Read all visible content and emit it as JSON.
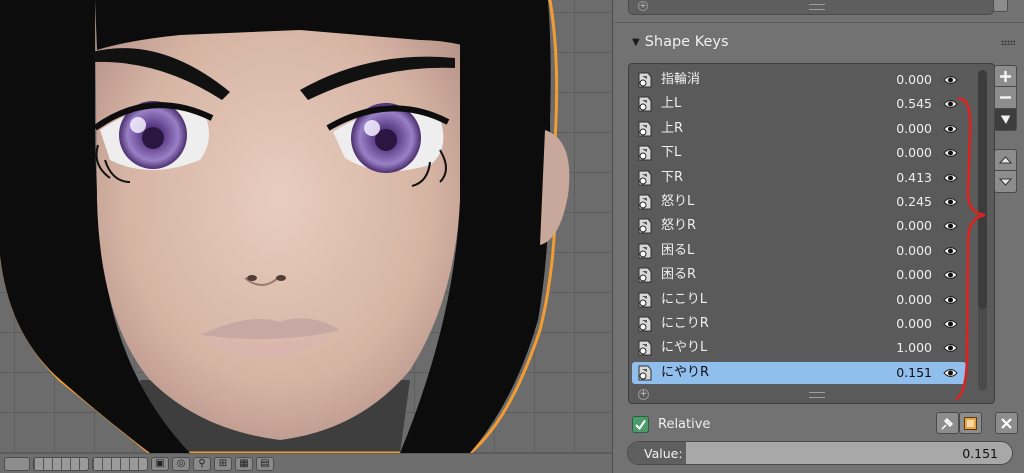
{
  "panel": {
    "title": "Shape Keys",
    "collapse_icon": "triangle-down-icon",
    "drag_icon": "drag-handle-icon"
  },
  "shape_keys": [
    {
      "name": "指輪消",
      "value": "0.000",
      "selected": false
    },
    {
      "name": "上L",
      "value": "0.545",
      "selected": false
    },
    {
      "name": "上R",
      "value": "0.000",
      "selected": false
    },
    {
      "name": "下L",
      "value": "0.000",
      "selected": false
    },
    {
      "name": "下R",
      "value": "0.413",
      "selected": false
    },
    {
      "name": "怒りL",
      "value": "0.245",
      "selected": false
    },
    {
      "name": "怒りR",
      "value": "0.000",
      "selected": false
    },
    {
      "name": "困るL",
      "value": "0.000",
      "selected": false
    },
    {
      "name": "困るR",
      "value": "0.000",
      "selected": false
    },
    {
      "name": "にこりL",
      "value": "0.000",
      "selected": false
    },
    {
      "name": "にこりR",
      "value": "0.000",
      "selected": false
    },
    {
      "name": "にやりL",
      "value": "1.000",
      "selected": false
    },
    {
      "name": "にやりR",
      "value": "0.151",
      "selected": true
    }
  ],
  "list_controls": {
    "add_icon": "plus-icon",
    "remove_icon": "minus-icon",
    "specials_icon": "dropdown-arrow-icon",
    "move_up_icon": "arrow-up-icon",
    "move_down_icon": "arrow-down-icon",
    "scroll_position": 0.0,
    "scroll_visible_fraction": 0.74
  },
  "relative": {
    "label": "Relative",
    "checked": true
  },
  "tools": {
    "pin_icon": "pin-icon",
    "edit_mode_icon": "edit-mode-icon",
    "clear_icon": "close-icon"
  },
  "value_field": {
    "label": "Value:",
    "value": "0.151",
    "fraction": 0.151
  },
  "colors": {
    "selected_row": "#90bfee",
    "checkbox": "#4b9b6b",
    "annotation": "#e0201c",
    "selection_outline": "#f29d32"
  },
  "annotation": {
    "type": "red-curly-brace"
  }
}
